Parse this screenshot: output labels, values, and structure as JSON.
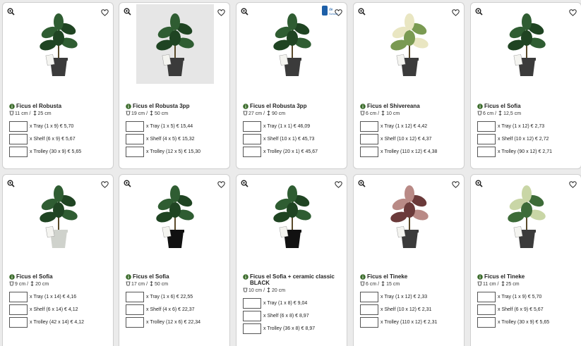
{
  "products": [
    {
      "name": "Ficus el Robusta",
      "pot": "11 cm",
      "height": "25 cm",
      "photo": false,
      "options": [
        "x Tray  (1 x 9) € 5,70",
        "x Shelf  (6 x 9) € 5,67",
        "x Trolley  (30 x 9) € 5,65"
      ]
    },
    {
      "name": "Ficus el Robusta 3pp",
      "pot": "19 cm",
      "height": "50 cm",
      "photo": true,
      "options": [
        "x Tray  (1 x 5) € 15,44",
        "x Shelf  (4 x 5) € 15,32",
        "x Trolley  (12 x 5) € 15,30"
      ]
    },
    {
      "name": "Ficus el Robusta 3pp",
      "pot": "27 cm",
      "height": "90 cm",
      "photo": false,
      "logo": true,
      "options": [
        "x Tray  (1 x 1) € 46,09",
        "x Shelf  (10 x 1) € 45,73",
        "x Trolley  (20 x 1) € 45,67"
      ]
    },
    {
      "name": "Ficus el Shivereana",
      "pot": "6 cm",
      "height": "10 cm",
      "photo": false,
      "options": [
        "x Tray  (1 x 12) € 4,42",
        "x Shelf  (10 x 12) € 4,37",
        "x Trolley  (110 x 12) € 4,38"
      ]
    },
    {
      "name": "Ficus el Sofia",
      "pot": "6 cm",
      "height": "12,5 cm",
      "photo": false,
      "options": [
        "x Tray  (1 x 12) € 2,73",
        "x Shelf  (10 x 12) € 2,72",
        "x Trolley  (90 x 12) € 2,71"
      ]
    },
    {
      "name": "Ficus el Sofia",
      "pot": "9 cm",
      "height": "20 cm",
      "photo": false,
      "options": [
        "x Tray  (1 x 14) € 4,16",
        "x Shelf  (6 x 14) € 4,12",
        "x Trolley  (42 x 14) € 4,12"
      ]
    },
    {
      "name": "Ficus el Sofia",
      "pot": "17 cm",
      "height": "50 cm",
      "photo": false,
      "options": [
        "x Tray  (1 x 6) € 22,55",
        "x Shelf  (4 x 6) € 22,37",
        "x Trolley  (12 x 6) € 22,34"
      ]
    },
    {
      "name": "Ficus el Sofia + ceramic classic BLACK",
      "pot": "10 cm",
      "height": "20 cm",
      "photo": false,
      "options": [
        "x Tray  (1 x 8) € 9,04",
        "x Shelf  (6 x 8) € 8,97",
        "x Trolley  (36 x 8) € 8,97"
      ]
    },
    {
      "name": "Ficus el Tineke",
      "pot": "6 cm",
      "height": "15 cm",
      "photo": false,
      "options": [
        "x Tray  (1 x 12) € 2,33",
        "x Shelf  (10 x 12) € 2,31",
        "x Trolley  (110 x 12) € 2,31"
      ]
    },
    {
      "name": "Ficus el Tineke",
      "pot": "11 cm",
      "height": "25 cm",
      "photo": false,
      "options": [
        "x Tray  (1 x 9) € 5,70",
        "x Shelf  (6 x 9) € 5,67",
        "x Trolley  (30 x 9) € 5,65"
      ]
    }
  ],
  "icons": {
    "zoom": "zoom-in-icon",
    "favorite": "heart-icon",
    "info": "info-icon",
    "pot": "pot-size-icon",
    "height": "height-icon"
  },
  "colors": {
    "leaf": "#2f5d32",
    "pot": "#333333",
    "info": "#3a6b2a"
  }
}
